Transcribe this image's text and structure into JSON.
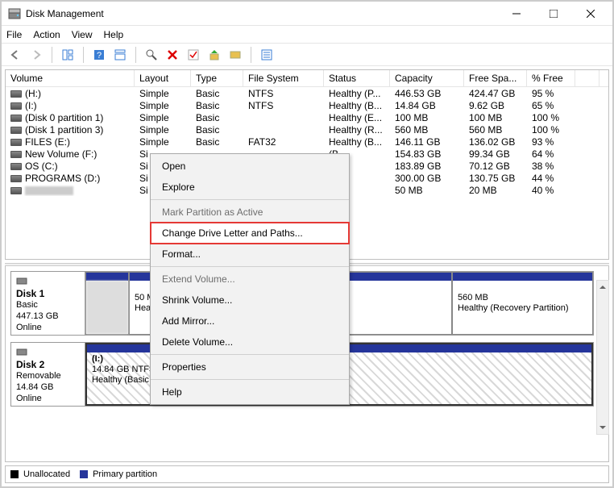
{
  "window": {
    "title": "Disk Management"
  },
  "menu": {
    "file": "File",
    "action": "Action",
    "view": "View",
    "help": "Help"
  },
  "table": {
    "headers": [
      "Volume",
      "Layout",
      "Type",
      "File System",
      "Status",
      "Capacity",
      "Free Spa...",
      "% Free"
    ],
    "rows": [
      {
        "volume": "(H:)",
        "layout": "Simple",
        "type": "Basic",
        "fs": "NTFS",
        "status": "Healthy (P...",
        "cap": "446.53 GB",
        "free": "424.47 GB",
        "pct": "95 %"
      },
      {
        "volume": "(I:)",
        "layout": "Simple",
        "type": "Basic",
        "fs": "NTFS",
        "status": "Healthy (B...",
        "cap": "14.84 GB",
        "free": "9.62 GB",
        "pct": "65 %"
      },
      {
        "volume": "(Disk 0 partition 1)",
        "layout": "Simple",
        "type": "Basic",
        "fs": "",
        "status": "Healthy (E...",
        "cap": "100 MB",
        "free": "100 MB",
        "pct": "100 %"
      },
      {
        "volume": "(Disk 1 partition 3)",
        "layout": "Simple",
        "type": "Basic",
        "fs": "",
        "status": "Healthy (R...",
        "cap": "560 MB",
        "free": "560 MB",
        "pct": "100 %"
      },
      {
        "volume": "FILES (E:)",
        "layout": "Simple",
        "type": "Basic",
        "fs": "FAT32",
        "status": "Healthy (B...",
        "cap": "146.11 GB",
        "free": "136.02 GB",
        "pct": "93 %"
      },
      {
        "volume": "New Volume (F:)",
        "layout": "Si",
        "type": "",
        "fs": "",
        "status": "(B...",
        "cap": "154.83 GB",
        "free": "99.34 GB",
        "pct": "64 %"
      },
      {
        "volume": "OS (C:)",
        "layout": "Si",
        "type": "",
        "fs": "",
        "status": "(B...",
        "cap": "183.89 GB",
        "free": "70.12 GB",
        "pct": "38 %"
      },
      {
        "volume": "PROGRAMS (D:)",
        "layout": "Si",
        "type": "",
        "fs": "",
        "status": "(B...",
        "cap": "300.00 GB",
        "free": "130.75 GB",
        "pct": "44 %"
      },
      {
        "volume": "",
        "layout": "Si",
        "type": "",
        "fs": "",
        "status": "(A...",
        "cap": "50 MB",
        "free": "20 MB",
        "pct": "40 %",
        "blurred": true
      }
    ]
  },
  "context_menu": {
    "open": "Open",
    "explore": "Explore",
    "mark": "Mark Partition as Active",
    "change": "Change Drive Letter and Paths...",
    "format": "Format...",
    "extend": "Extend Volume...",
    "shrink": "Shrink Volume...",
    "mirror": "Add Mirror...",
    "delete": "Delete Volume...",
    "properties": "Properties",
    "help": "Help"
  },
  "disks": {
    "d1": {
      "name": "Disk 1",
      "type": "Basic",
      "size": "447.13 GB",
      "status": "Online",
      "p1": {
        "size": "50 MB",
        "state": "Healthy"
      },
      "p3": {
        "size": "560 MB",
        "state": "Healthy (Recovery Partition)"
      }
    },
    "d2": {
      "name": "Disk 2",
      "type": "Removable",
      "size": "14.84 GB",
      "status": "Online",
      "p1": {
        "name": "(I:)",
        "size": "14.84 GB NTFS",
        "state": "Healthy (Basic Data Partition)"
      }
    }
  },
  "legend": {
    "unalloc": "Unallocated",
    "primary": "Primary partition"
  }
}
